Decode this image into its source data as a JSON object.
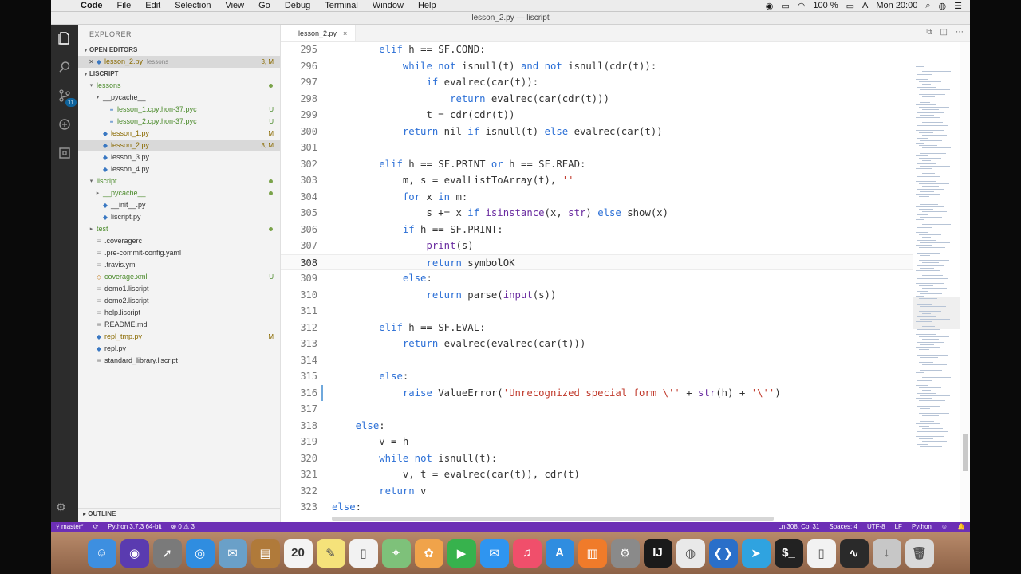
{
  "menubar": {
    "apple": "",
    "app": "Code",
    "items": [
      "File",
      "Edit",
      "Selection",
      "View",
      "Go",
      "Debug",
      "Terminal",
      "Window",
      "Help"
    ],
    "battery": "100 %",
    "clock": "Mon 20:00"
  },
  "window": {
    "title": "lesson_2.py — liscript"
  },
  "activity": {
    "scm_badge": "11"
  },
  "sidebar": {
    "title": "EXPLORER",
    "open_editors_label": "OPEN EDITORS",
    "open_editor": {
      "name": "lesson_2.py",
      "hint": "lessons",
      "status": "3, M"
    },
    "project_label": "LISCRIPT",
    "tree": [
      {
        "name": "lessons",
        "type": "folder",
        "indent": 1,
        "open": true,
        "dot": true
      },
      {
        "name": "__pycache__",
        "type": "folder",
        "indent": 2,
        "open": true,
        "dot": false
      },
      {
        "name": "lesson_1.cpython-37.pyc",
        "type": "file",
        "indent": 3,
        "status": "U"
      },
      {
        "name": "lesson_2.cpython-37.pyc",
        "type": "file",
        "indent": 3,
        "status": "U"
      },
      {
        "name": "lesson_1.py",
        "type": "py",
        "indent": 2,
        "status": "M"
      },
      {
        "name": "lesson_2.py",
        "type": "py",
        "indent": 2,
        "status": "3, M",
        "selected": true
      },
      {
        "name": "lesson_3.py",
        "type": "py",
        "indent": 2
      },
      {
        "name": "lesson_4.py",
        "type": "py",
        "indent": 2
      },
      {
        "name": "liscript",
        "type": "folder",
        "indent": 1,
        "open": true,
        "dot": true
      },
      {
        "name": "__pycache__",
        "type": "folder",
        "indent": 2,
        "open": false,
        "dot": true
      },
      {
        "name": "__init__.py",
        "type": "py",
        "indent": 2
      },
      {
        "name": "liscript.py",
        "type": "py",
        "indent": 2
      },
      {
        "name": "test",
        "type": "folder",
        "indent": 1,
        "open": false,
        "dot": true
      },
      {
        "name": ".coveragerc",
        "type": "config",
        "indent": 1
      },
      {
        "name": ".pre-commit-config.yaml",
        "type": "config",
        "indent": 1
      },
      {
        "name": ".travis.yml",
        "type": "config",
        "indent": 1
      },
      {
        "name": "coverage.xml",
        "type": "xml",
        "indent": 1,
        "status": "U"
      },
      {
        "name": "demo1.liscript",
        "type": "config",
        "indent": 1
      },
      {
        "name": "demo2.liscript",
        "type": "config",
        "indent": 1
      },
      {
        "name": "help.liscript",
        "type": "config",
        "indent": 1
      },
      {
        "name": "README.md",
        "type": "config",
        "indent": 1
      },
      {
        "name": "repl_tmp.py",
        "type": "py",
        "indent": 1,
        "status": "M"
      },
      {
        "name": "repl.py",
        "type": "py",
        "indent": 1
      },
      {
        "name": "standard_library.liscript",
        "type": "config",
        "indent": 1
      }
    ],
    "outline_label": "OUTLINE"
  },
  "editor": {
    "tab": {
      "name": "lesson_2.py",
      "close": "×"
    },
    "current_line": 308,
    "lines": [
      {
        "n": 295,
        "code": "        elif h == SF.COND:"
      },
      {
        "n": 296,
        "code": "            while not isnull(t) and not isnull(cdr(t)):"
      },
      {
        "n": 297,
        "code": "                if evalrec(car(t)):"
      },
      {
        "n": 298,
        "code": "                    return evalrec(car(cdr(t)))"
      },
      {
        "n": 299,
        "code": "                t = cdr(cdr(t))"
      },
      {
        "n": 300,
        "code": "            return nil if isnull(t) else evalrec(car(t))"
      },
      {
        "n": 301,
        "code": ""
      },
      {
        "n": 302,
        "code": "        elif h == SF.PRINT or h == SF.READ:"
      },
      {
        "n": 303,
        "code": "            m, s = evalListToArray(t), ''"
      },
      {
        "n": 304,
        "code": "            for x in m:"
      },
      {
        "n": 305,
        "code": "                s += x if isinstance(x, str) else show(x)"
      },
      {
        "n": 306,
        "code": "            if h == SF.PRINT:"
      },
      {
        "n": 307,
        "code": "                print(s)"
      },
      {
        "n": 308,
        "code": "                return symbolOK"
      },
      {
        "n": 309,
        "code": "            else:"
      },
      {
        "n": 310,
        "code": "                return parse(input(s))"
      },
      {
        "n": 311,
        "code": ""
      },
      {
        "n": 312,
        "code": "        elif h == SF.EVAL:"
      },
      {
        "n": 313,
        "code": "            return evalrec(evalrec(car(t)))"
      },
      {
        "n": 314,
        "code": ""
      },
      {
        "n": 315,
        "code": "        else:"
      },
      {
        "n": 316,
        "code": "            raise ValueError('Unrecognized special form \\'' + str(h) + '\\'')"
      },
      {
        "n": 317,
        "code": ""
      },
      {
        "n": 318,
        "code": "    else:"
      },
      {
        "n": 319,
        "code": "        v = h"
      },
      {
        "n": 320,
        "code": "        while not isnull(t):"
      },
      {
        "n": 321,
        "code": "            v, t = evalrec(car(t)), cdr(t)"
      },
      {
        "n": 322,
        "code": "        return v"
      },
      {
        "n": 323,
        "code": "else:"
      }
    ]
  },
  "statusbar": {
    "branch": "master*",
    "interpreter": "Python 3.7.3 64-bit",
    "problems": "⊗ 0 ⚠ 3",
    "position": "Ln 308, Col 31",
    "spaces": "Spaces: 4",
    "encoding": "UTF-8",
    "eol": "LF",
    "language": "Python"
  },
  "dock": {
    "calendar_day": "20",
    "items": [
      {
        "name": "finder",
        "color": "#3d8fe0",
        "glyph": "☺"
      },
      {
        "name": "siri",
        "color": "#5a3bb0",
        "glyph": "◉"
      },
      {
        "name": "launchpad",
        "color": "#7a7a7a",
        "glyph": "➚"
      },
      {
        "name": "safari",
        "color": "#2f8de0",
        "glyph": "◎"
      },
      {
        "name": "mail-stamp",
        "color": "#6aa0c8",
        "glyph": "✉"
      },
      {
        "name": "notes-brown",
        "color": "#b07a3a",
        "glyph": "▤"
      },
      {
        "name": "calendar",
        "color": "#f4f4f4",
        "glyph": "20"
      },
      {
        "name": "notes",
        "color": "#f5e27a",
        "glyph": "✎"
      },
      {
        "name": "textedit",
        "color": "#f2f2f2",
        "glyph": "▯"
      },
      {
        "name": "maps",
        "color": "#7ec17a",
        "glyph": "⌖"
      },
      {
        "name": "photos",
        "color": "#f0a34a",
        "glyph": "✿"
      },
      {
        "name": "facetime",
        "color": "#37b24d",
        "glyph": "▶"
      },
      {
        "name": "messages",
        "color": "#2f95f0",
        "glyph": "✉"
      },
      {
        "name": "music",
        "color": "#f04f6b",
        "glyph": "♫"
      },
      {
        "name": "app-store",
        "color": "#2f8de0",
        "glyph": "A"
      },
      {
        "name": "books",
        "color": "#f07b2a",
        "glyph": "▥"
      },
      {
        "name": "system-preferences",
        "color": "#8a8a8a",
        "glyph": "⚙"
      },
      {
        "name": "intellij",
        "color": "#1a1a1a",
        "glyph": "IJ"
      },
      {
        "name": "chrome",
        "color": "#e9e9e9",
        "glyph": "◍"
      },
      {
        "name": "vscode",
        "color": "#2a6fc9",
        "glyph": "❮❯"
      },
      {
        "name": "telegram",
        "color": "#2fa3e0",
        "glyph": "➤"
      },
      {
        "name": "terminal",
        "color": "#222222",
        "glyph": "$_"
      },
      {
        "name": "document",
        "color": "#f2f2f2",
        "glyph": "▯"
      },
      {
        "name": "activity-monitor",
        "color": "#2a2a2a",
        "glyph": "∿"
      },
      {
        "name": "downloads",
        "color": "#c7c7c7",
        "glyph": "↓"
      },
      {
        "name": "trash",
        "color": "#d9d9d9",
        "glyph": "🗑"
      }
    ]
  },
  "colors": {
    "statusbar": "#6c2fb5",
    "keyword": "#2b6fd6",
    "builtin": "#6a2ca0",
    "string": "#c0392b"
  }
}
